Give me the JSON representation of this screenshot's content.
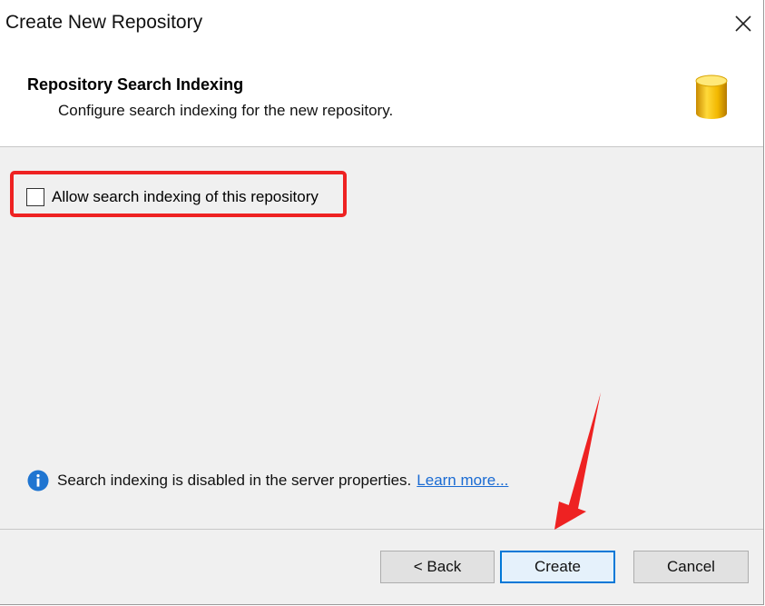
{
  "window": {
    "title": "Create New Repository"
  },
  "header": {
    "title": "Repository Search Indexing",
    "subtitle": "Configure search indexing for the new repository.",
    "icon": "database-icon"
  },
  "options": {
    "allow_indexing_label": "Allow search indexing of this repository",
    "allow_indexing_checked": false
  },
  "info": {
    "icon": "info-icon",
    "text": "Search indexing is disabled in the server properties.",
    "link_text": "Learn more..."
  },
  "buttons": {
    "back": "< Back",
    "create": "Create",
    "cancel": "Cancel"
  },
  "colors": {
    "highlight": "#ee2222",
    "accent": "#0078d7",
    "link": "#1a6bd3"
  }
}
